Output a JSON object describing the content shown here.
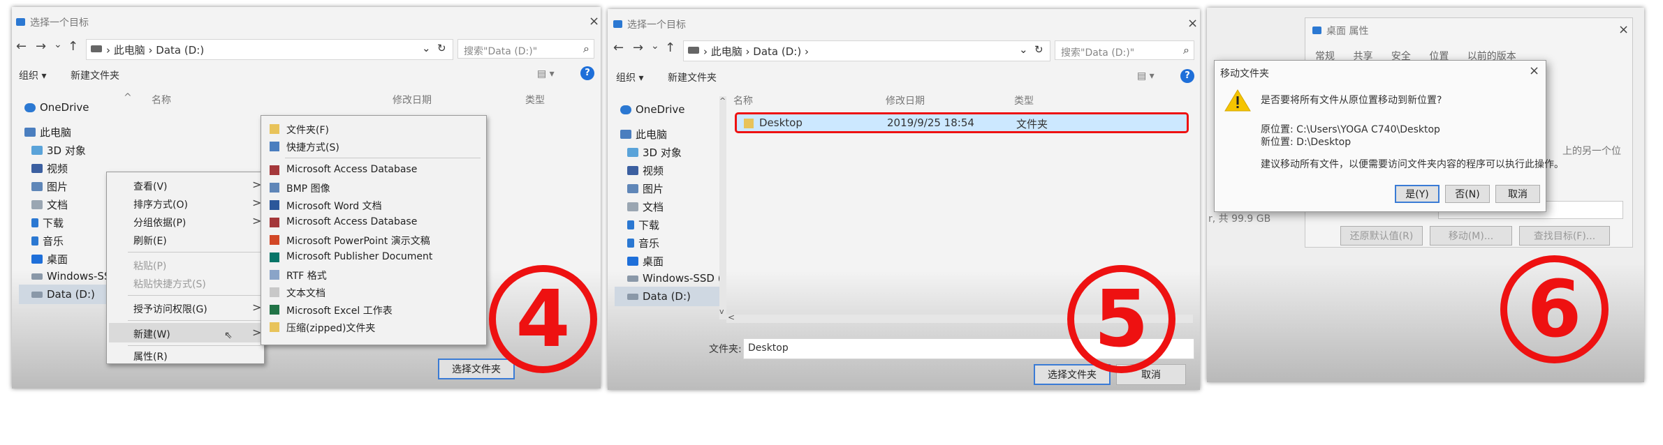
{
  "panel1": {
    "title": "选择一个目标",
    "close": "×",
    "nav": {
      "back": "←",
      "forward": "→",
      "down": "⌄",
      "up": "↑",
      "path": "› 此电脑 › Data (D:)",
      "dropdown": "⌄",
      "refresh": "↻"
    },
    "search_placeholder": "搜索\"Data (D:)\"",
    "search_icon": "⌕",
    "toolbar": {
      "organize": "组织 ▾",
      "new_folder": "新建文件夹",
      "view": "▤ ▾",
      "help": "?"
    },
    "columns": {
      "name": "名称",
      "date": "修改日期",
      "type": "类型"
    },
    "sidebar": [
      "OneDrive",
      "此电脑",
      "3D 对象",
      "视频",
      "图片",
      "文档",
      "下载",
      "音乐",
      "桌面",
      "Windows-SS",
      "Data (D:)"
    ],
    "context_menu": [
      {
        "label": "查看(V)",
        "arrow": ">"
      },
      {
        "label": "排序方式(O)",
        "arrow": ">"
      },
      {
        "label": "分组依据(P)",
        "arrow": ">"
      },
      {
        "label": "刷新(E)",
        "arrow": ""
      },
      {
        "label": "粘贴(P)",
        "arrow": ""
      },
      {
        "label": "粘贴快捷方式(S)",
        "arrow": ""
      },
      {
        "label": "授予访问权限(G)",
        "arrow": ">"
      },
      {
        "label": "新建(W)",
        "arrow": ">"
      },
      {
        "label": "属性(R)",
        "arrow": ""
      }
    ],
    "submenu": [
      "文件夹(F)",
      "快捷方式(S)",
      "Microsoft Access Database",
      "BMP 图像",
      "Microsoft Word 文档",
      "Microsoft Access Database",
      "Microsoft PowerPoint 演示文稿",
      "Microsoft Publisher Document",
      "RTF 格式",
      "文本文档",
      "Microsoft Excel 工作表",
      "压缩(zipped)文件夹"
    ],
    "select_button": "选择文件夹",
    "step": "4"
  },
  "panel2": {
    "title": "选择一个目标",
    "close": "×",
    "nav": {
      "back": "←",
      "forward": "→",
      "down": "⌄",
      "up": "↑",
      "path": "› 此电脑 › Data (D:) ›",
      "dropdown": "⌄",
      "refresh": "↻"
    },
    "search_placeholder": "搜索\"Data (D:)\"",
    "search_icon": "⌕",
    "toolbar": {
      "organize": "组织 ▾",
      "new_folder": "新建文件夹",
      "view": "▤ ▾",
      "help": "?"
    },
    "columns": {
      "name": "名称",
      "date": "修改日期",
      "type": "类型"
    },
    "sidebar": [
      "OneDrive",
      "此电脑",
      "3D 对象",
      "视频",
      "图片",
      "文档",
      "下载",
      "音乐",
      "桌面",
      "Windows-SSD (",
      "Data (D:)"
    ],
    "file": {
      "name": "Desktop",
      "date": "2019/9/25 18:54",
      "type": "文件夹"
    },
    "folder_label": "文件夹:",
    "folder_value": "Desktop",
    "select_button": "选择文件夹",
    "cancel_button": "取消",
    "step": "5"
  },
  "panel3": {
    "bg_title": "桌面 属性",
    "bg_close": "×",
    "bg_tabs": [
      "常规",
      "共享",
      "安全",
      "位置",
      "以前的版本"
    ],
    "bg_side_text": "上的另一个位",
    "bg_buttons": [
      "还原默认值(R)",
      "移动(M)...",
      "查找目标(F)..."
    ],
    "bg_left_text": "r, 共 99.9 GB",
    "dialog": {
      "title": "移动文件夹",
      "close": "×",
      "question": "是否要将所有文件从原位置移动到新位置?",
      "source": "原位置: C:\\Users\\YOGA C740\\Desktop",
      "target": "新位置: D:\\Desktop",
      "advice": "建议移动所有文件，以便需要访问文件夹内容的程序可以执行此操作。",
      "yes": "是(Y)",
      "no": "否(N)",
      "cancel": "取消"
    },
    "step": "6"
  },
  "colors": {
    "annotation_red": "#ee1111",
    "selection_blue": "#cce8ff",
    "warning_yellow": "#f5c400",
    "accent_blue": "#1e6fd9"
  }
}
